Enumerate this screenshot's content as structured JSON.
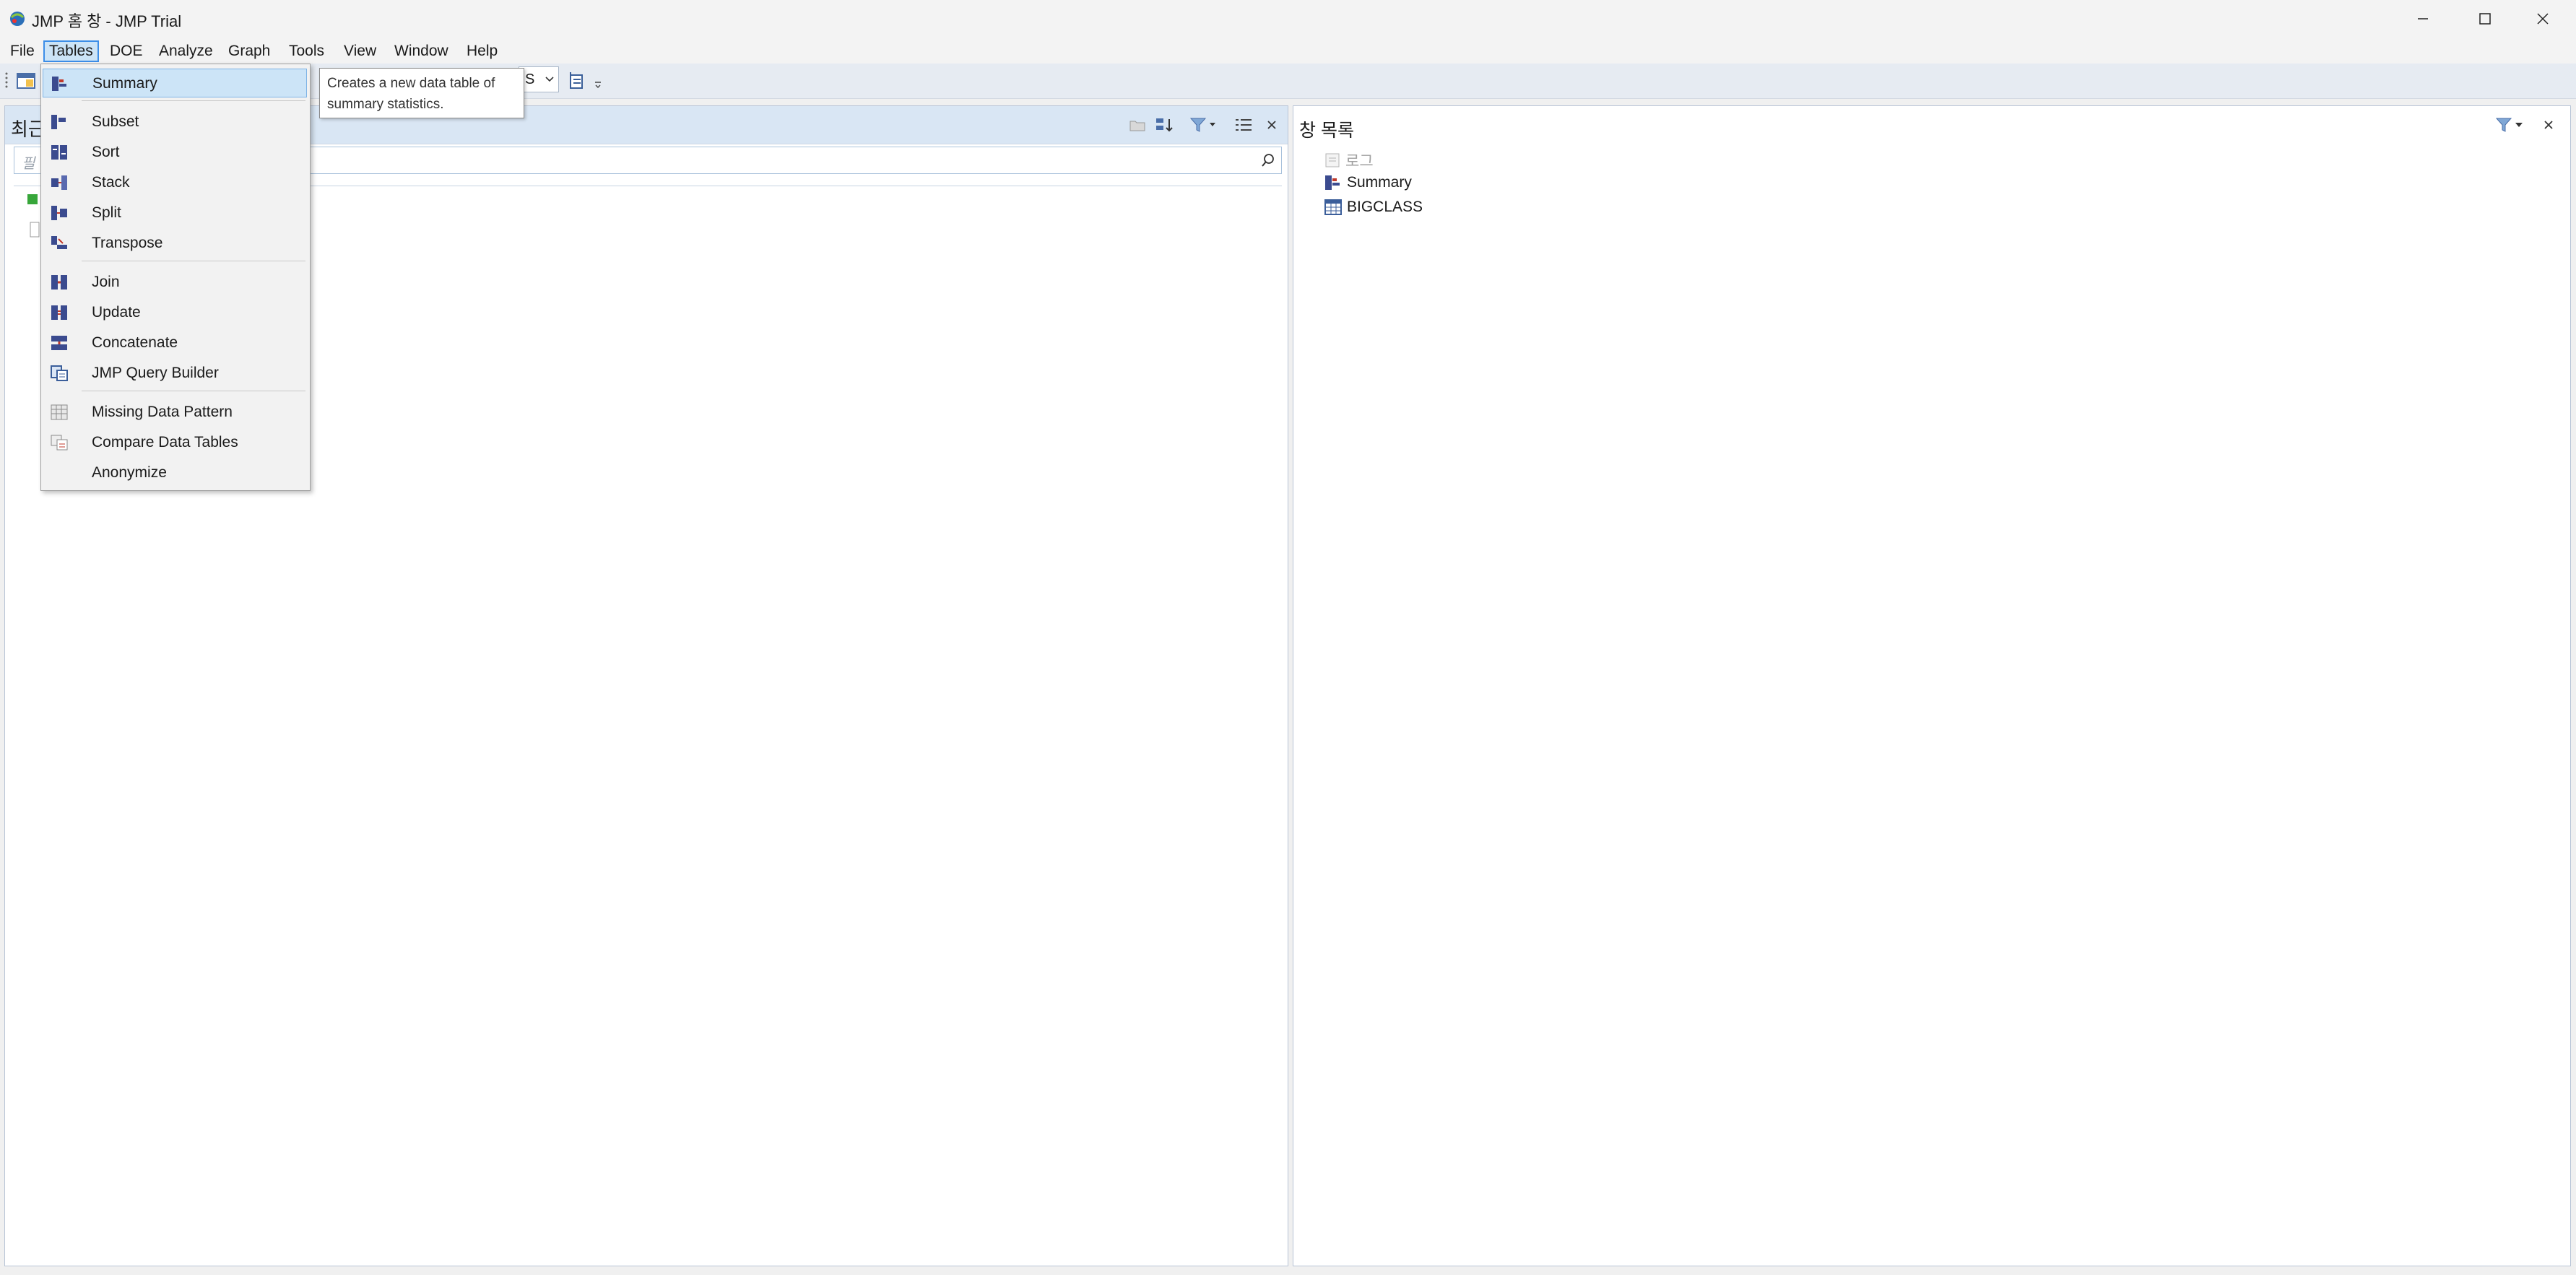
{
  "window": {
    "title": "JMP 홈 창 - JMP Trial"
  },
  "menubar": {
    "items": [
      "File",
      "Tables",
      "DOE",
      "Analyze",
      "Graph",
      "Tools",
      "View",
      "Window",
      "Help"
    ],
    "active": "Tables"
  },
  "toolbar": {
    "combo_value": "S"
  },
  "left_panel": {
    "title": "최근",
    "search_placeholder": "필"
  },
  "right_panel": {
    "title": "창 목록",
    "items": [
      {
        "label": "로그",
        "icon": "log-icon",
        "disabled": true
      },
      {
        "label": "Summary",
        "icon": "summary-table-icon",
        "disabled": false
      },
      {
        "label": "BIGCLASS",
        "icon": "data-table-icon",
        "disabled": false
      }
    ]
  },
  "tables_menu": {
    "groups": [
      [
        {
          "label": "Summary",
          "icon": "summary-icon",
          "highlighted": true
        }
      ],
      [
        {
          "label": "Subset",
          "icon": "subset-icon"
        },
        {
          "label": "Sort",
          "icon": "sort-icon"
        },
        {
          "label": "Stack",
          "icon": "stack-icon"
        },
        {
          "label": "Split",
          "icon": "split-icon"
        },
        {
          "label": "Transpose",
          "icon": "transpose-icon"
        }
      ],
      [
        {
          "label": "Join",
          "icon": "join-icon"
        },
        {
          "label": "Update",
          "icon": "update-icon"
        },
        {
          "label": "Concatenate",
          "icon": "concatenate-icon"
        },
        {
          "label": "JMP Query Builder",
          "icon": "query-builder-icon"
        }
      ],
      [
        {
          "label": "Missing Data Pattern",
          "icon": "missing-data-icon"
        },
        {
          "label": "Compare Data Tables",
          "icon": "compare-tables-icon"
        },
        {
          "label": "Anonymize",
          "icon": ""
        }
      ]
    ]
  },
  "tooltip": {
    "line1": "Creates a new data table of",
    "line2": "summary statistics."
  },
  "colors": {
    "menu_highlight": "#cce4f7",
    "menu_highlight_border": "#3c8ee8",
    "panel_header": "#e4ebf4"
  }
}
